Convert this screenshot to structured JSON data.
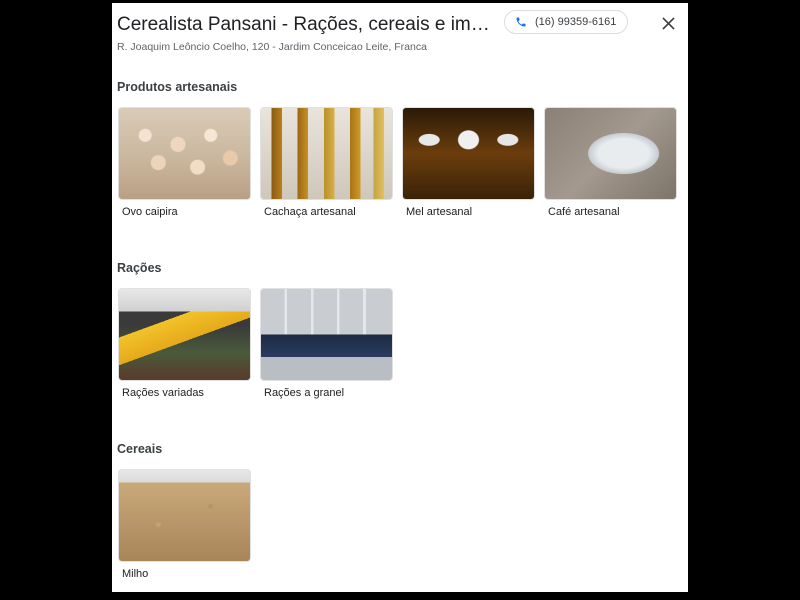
{
  "header": {
    "title": "Cerealista Pansani - Rações, cereais e impl...",
    "phone": "(16) 99359-6161",
    "address": "R. Joaquim Leôncio Coelho, 120 - Jardim Conceicao Leite, Franca"
  },
  "sections": [
    {
      "title": "Produtos artesanais",
      "items": [
        {
          "label": "Ovo caipira",
          "image": "eggs"
        },
        {
          "label": "Cachaça artesanal",
          "image": "cachaca-bottles"
        },
        {
          "label": "Mel artesanal",
          "image": "honey-jars"
        },
        {
          "label": "Café artesanal",
          "image": "coffee-bag"
        }
      ]
    },
    {
      "title": "Rações",
      "items": [
        {
          "label": "Rações variadas",
          "image": "feed-bags"
        },
        {
          "label": "Rações a granel",
          "image": "bulk-feed-dispensers"
        }
      ]
    },
    {
      "title": "Cereais",
      "items": [
        {
          "label": "Milho",
          "image": "corn-grain"
        }
      ]
    }
  ],
  "icons": {
    "phone": "phone-icon",
    "close": "close-icon"
  },
  "colors": {
    "phone_icon": "#1a73e8",
    "text_primary": "#202124",
    "text_secondary": "#5f6368"
  }
}
